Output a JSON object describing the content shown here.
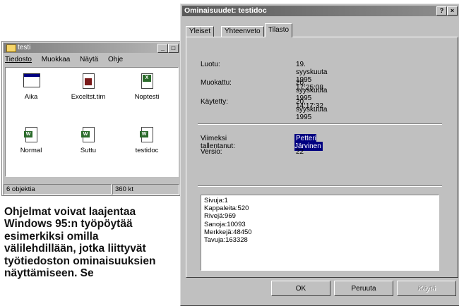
{
  "explorer": {
    "title": "testi",
    "menu": [
      "Tiedosto",
      "Muokkaa",
      "Näytä",
      "Ohje"
    ],
    "items": [
      {
        "label": "Aika",
        "icon": "window-icon"
      },
      {
        "label": "Exceltst.tim",
        "icon": "binder-doc-icon"
      },
      {
        "label": "Noptesti",
        "icon": "excel-doc-icon"
      },
      {
        "label": "Normal",
        "icon": "word-doc-icon"
      },
      {
        "label": "Suttu",
        "icon": "word-doc-icon"
      },
      {
        "label": "testidoc",
        "icon": "word-doc-icon"
      }
    ],
    "status_count": "6 objektia",
    "status_size": "360 kt"
  },
  "dialog": {
    "title": "Ominaisuudet: testidoc",
    "help_btn": "?",
    "close_btn": "×",
    "tabs": [
      "Yleiset",
      "Yhteenveto",
      "Tilasto"
    ],
    "active_tab": "Tilasto",
    "rows": {
      "created_label": "Luotu:",
      "created_value": "19. syyskuuta 1995 17:25:08",
      "modified_label": "Muokattu:",
      "modified_value": "20. syyskuuta 1995 14:17:32",
      "accessed_label": "Käytetty:",
      "accessed_value": "20. syyskuuta 1995",
      "saved_by_label": "Viimeksi tallentanut:",
      "saved_by_value": "Petteri Järvinen",
      "version_label": "Versio:",
      "version_value": "22"
    },
    "stats": [
      "Sivuja:1",
      "Kappaleita:520",
      "Rivejä:969",
      "Sanoja:10093",
      "Merkkejä:48450",
      "Tavuja:163328"
    ],
    "buttons": {
      "ok": "OK",
      "cancel": "Peruuta",
      "apply": "Käytä"
    }
  },
  "caption": "Ohjelmat voivat laajentaa Windows 95:n työpöytää esimerkiksi omilla välilehdillään, jotka liittyvät työtiedoston ominaisuuksien näyttämiseen. Se"
}
